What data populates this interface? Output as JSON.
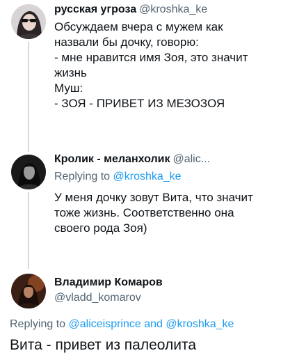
{
  "tweet1": {
    "display_name": "русская угроза",
    "handle": "@kroshka_ke",
    "lines": [
      "Обсуждаем вчера с мужем как",
      "назвали бы дочку, говорю:",
      "- мне нравится имя Зоя, это значит",
      "жизнь",
      "Муш:",
      "- ЗОЯ - ПРИВЕТ ИЗ МЕЗОЗОЯ"
    ]
  },
  "tweet2": {
    "display_name": "Кролик - меланхолик",
    "handle": "@alic...",
    "replying_prefix": "Replying to",
    "replying_mention": "@kroshka_ke",
    "lines": [
      "У меня дочку зовут Вита, что значит",
      "тоже жизнь. Соответственно она",
      "своего рода Зоя)"
    ]
  },
  "tweet3": {
    "display_name": "Владимир Комаров",
    "handle": "@vladd_komarov",
    "replying_prefix": "Replying to",
    "replying_mention_1": "@aliceisprince",
    "replying_and": "and",
    "replying_mention_2": "@kroshka_ke",
    "text": "Вита - привет из палеолита"
  },
  "colors": {
    "text": "#0f1419",
    "secondary": "#536471",
    "link": "#1d9bf0",
    "thread_line": "#cfd9de"
  }
}
